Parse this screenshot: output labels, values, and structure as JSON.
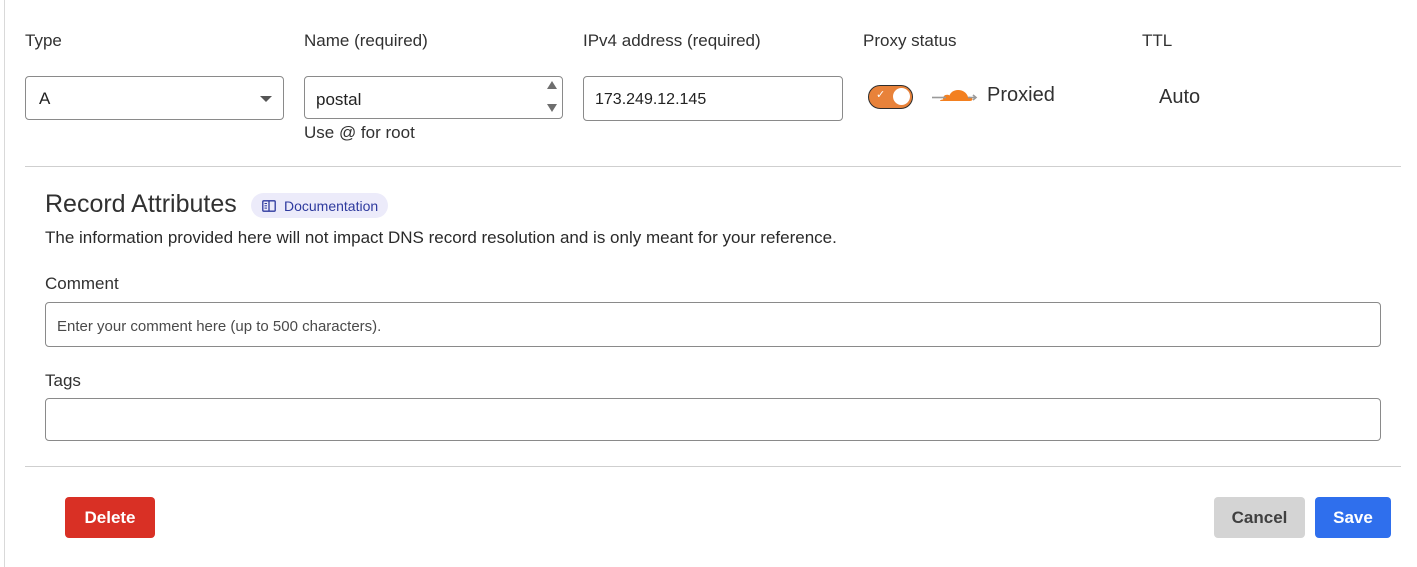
{
  "headers": {
    "type": "Type",
    "name": "Name (required)",
    "ipv4": "IPv4 address (required)",
    "proxy": "Proxy status",
    "ttl": "TTL"
  },
  "fields": {
    "type_value": "A",
    "name_value": "postal",
    "name_hint": "Use @ for root",
    "ipv4_value": "173.249.12.145",
    "proxy_enabled": true,
    "proxy_label": "Proxied",
    "ttl_value": "Auto"
  },
  "attributes": {
    "title": "Record Attributes",
    "doc_label": "Documentation",
    "description": "The information provided here will not impact DNS record resolution and is only meant for your reference.",
    "comment_label": "Comment",
    "comment_placeholder": "Enter your comment here (up to 500 characters).",
    "tags_label": "Tags"
  },
  "actions": {
    "delete": "Delete",
    "cancel": "Cancel",
    "save": "Save"
  },
  "colors": {
    "accent_orange": "#e8823a",
    "delete_red": "#d93025",
    "save_blue": "#2f6fed"
  },
  "icons": {
    "proxy": "cloud-icon",
    "docs": "book-icon",
    "select": "chevron-down-icon"
  }
}
